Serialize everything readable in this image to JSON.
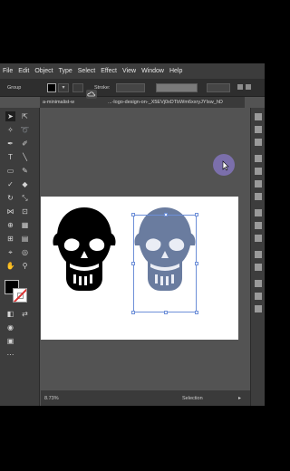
{
  "menu": [
    "File",
    "Edit",
    "Object",
    "Type",
    "Select",
    "Effect",
    "View",
    "Window",
    "Help"
  ],
  "control_bar": {
    "group_label": "Group",
    "stroke_label": "Stroke:",
    "colors": {
      "fill": "#000000"
    }
  },
  "document_tab": {
    "title_start": "a-minimalist-w",
    "title_rest": "...-logo-design-on-_X5EVj0xDTbWm6xxryJYIsw_hD"
  },
  "status": {
    "zoom": "8.73%",
    "mode": "Selection"
  },
  "icons": {
    "cloud": "cloud-icon",
    "selection": "selection-tool-icon",
    "direct_selection": "direct-selection-tool-icon",
    "pen": "pen-tool-icon",
    "type": "type-tool-icon",
    "rectangle": "rectangle-tool-icon",
    "brush": "paintbrush-tool-icon",
    "eraser": "eraser-tool-icon",
    "rotate": "rotate-tool-icon",
    "hand": "hand-tool-icon",
    "zoom": "zoom-tool-icon"
  },
  "colors": {
    "ui_dark": "#3d3d3d",
    "canvas": "#535353",
    "selection": "#6d8fd8",
    "trace_skull": "#5a6e95"
  }
}
